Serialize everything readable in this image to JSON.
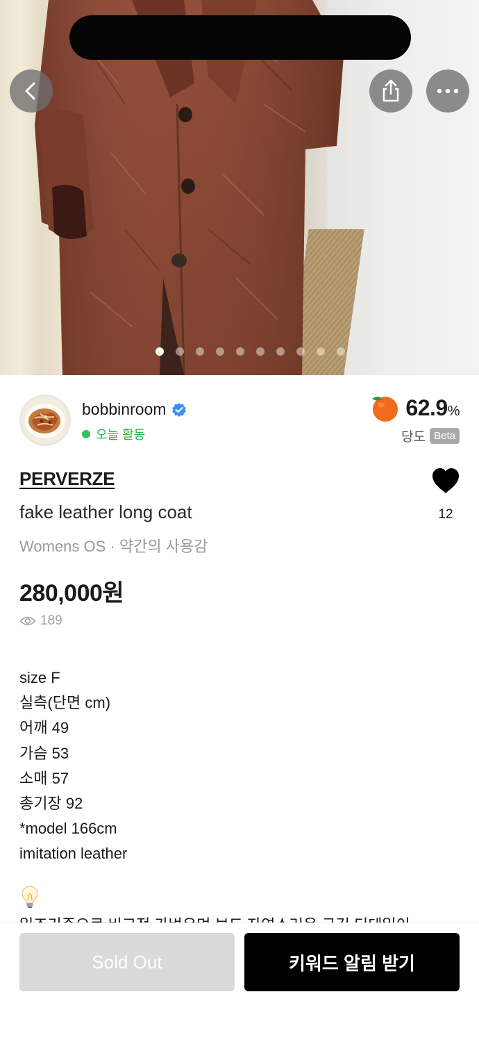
{
  "gallery": {
    "image_count": 10,
    "active_index": 0
  },
  "header": {
    "back_icon": "chevron-left-icon",
    "share_icon": "share-icon",
    "more_icon": "more-horizontal-icon"
  },
  "seller": {
    "name": "bobbinroom",
    "verified": true,
    "activity": "오늘 활동",
    "sweetness_value": "62.9",
    "sweetness_unit": "%",
    "sweetness_label": "당도",
    "sweetness_badge": "Beta"
  },
  "product": {
    "brand": "PERVERZE",
    "title": "fake leather long coat",
    "meta": "Womens OS · 약간의 사용감",
    "price": "280,000원",
    "views": "189",
    "likes": "12"
  },
  "description": {
    "lines": [
      "size F",
      "실측(단면 cm)",
      "어깨 49",
      "가슴 53",
      "소매 57",
      "총기장 92",
      "*model 166cm",
      "imitation leather"
    ],
    "cut_off_line": "일조기준으로 비교적 가벼우며 보드 자연스러운 구김 디테일이"
  },
  "actions": {
    "sold_out": "Sold Out",
    "keyword_alert": "키워드 알림 받기"
  },
  "colors": {
    "accent_green": "#2ab34a",
    "primary_button": "#000000",
    "disabled_button": "#dadada",
    "coat_brown": "#8a4a34"
  }
}
